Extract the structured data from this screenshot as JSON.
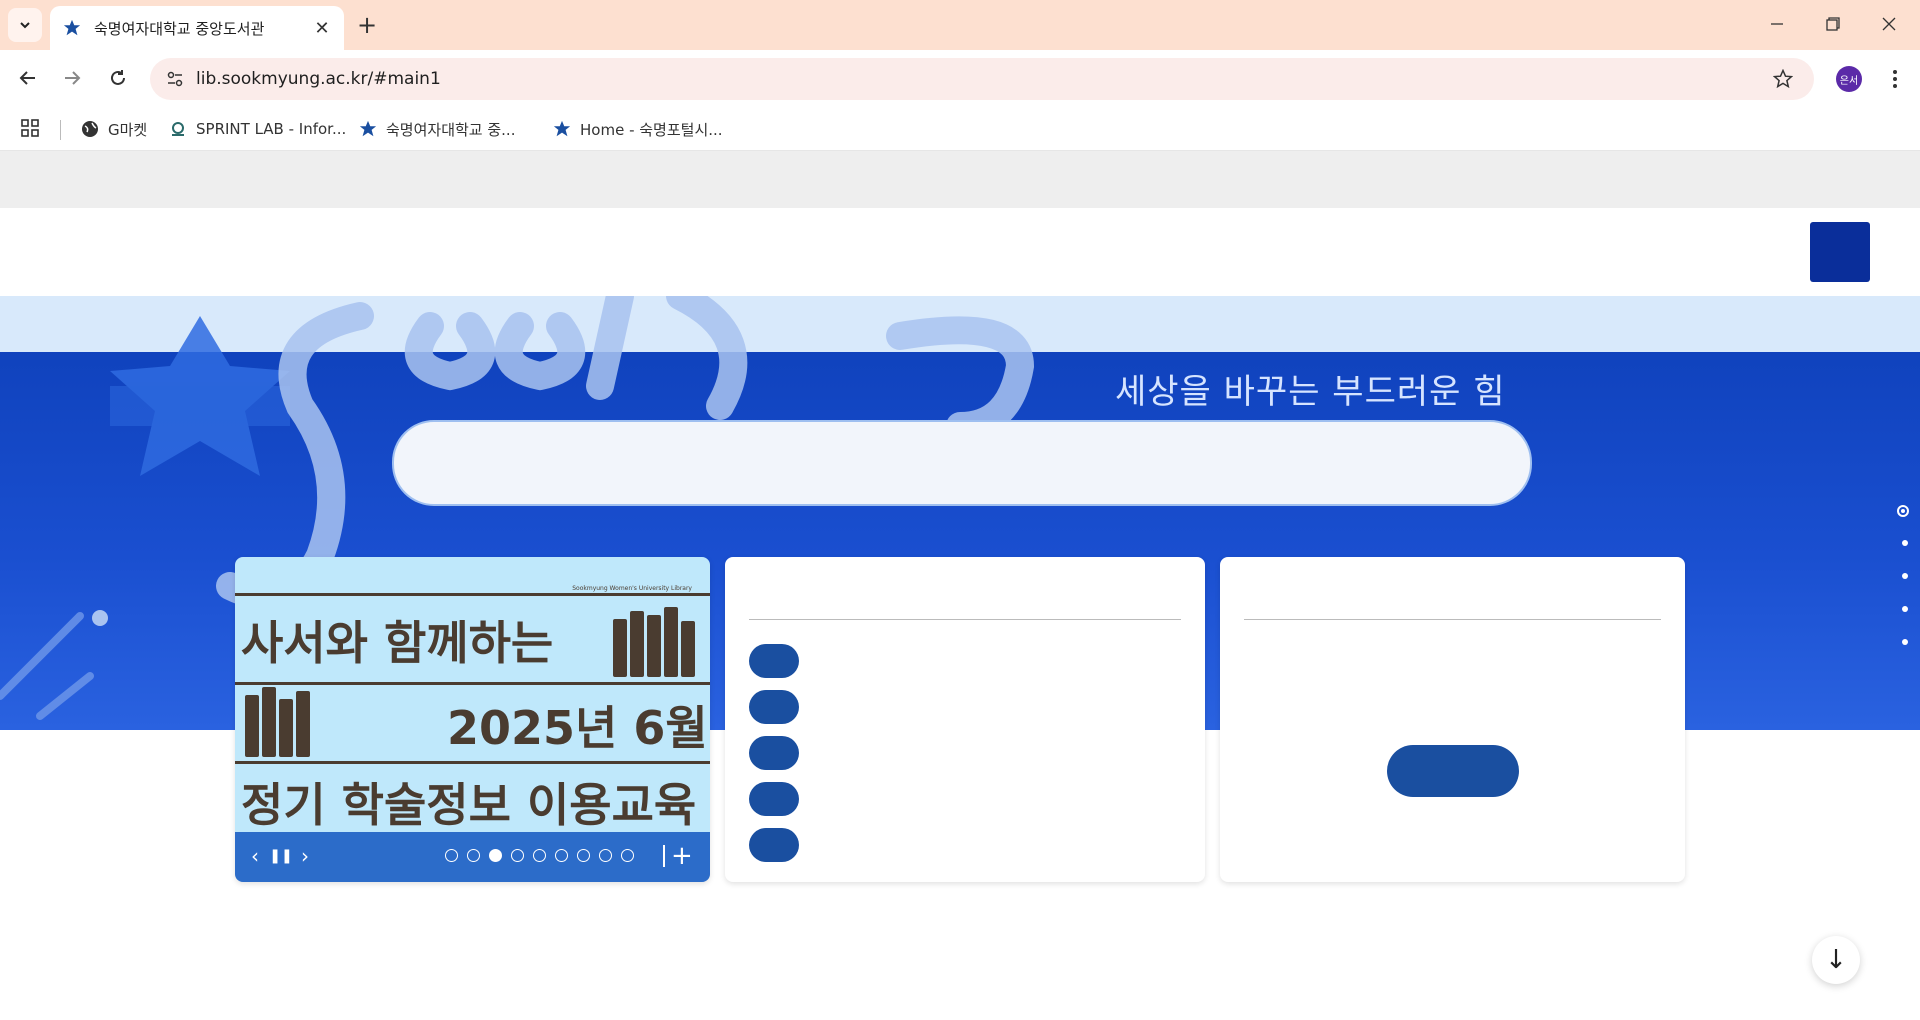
{
  "browser": {
    "tab_title": "숙명여자대학교 중앙도서관",
    "url": "lib.sookmyung.ac.kr/#main1",
    "profile_initials": "은서",
    "bookmarks": [
      {
        "label": "G마켓",
        "icon": "globe-icon"
      },
      {
        "label": "SPRINT LAB - Infor...",
        "icon": "lab-icon"
      },
      {
        "label": "숙명여자대학교 중...",
        "icon": "sookmyung-emblem-icon"
      },
      {
        "label": "Home - 숙명포털시...",
        "icon": "sookmyung-emblem-icon"
      }
    ]
  },
  "hero": {
    "slogan": "세상을 바꾸는 부드러운 힘"
  },
  "banner": {
    "small_caption": "Sookmyung Women's University Library",
    "line1": "사서와 함께하는",
    "line2": "2025년 6월",
    "line3": "정기 학술정보 이용교육",
    "slides_total": 9,
    "active_slide": 3
  },
  "colors": {
    "hero_blue": "#0d3fb8",
    "accent_navy": "#1a4fa0",
    "banner_bg": "#bfe8fb",
    "banner_text": "#4a3c30"
  }
}
